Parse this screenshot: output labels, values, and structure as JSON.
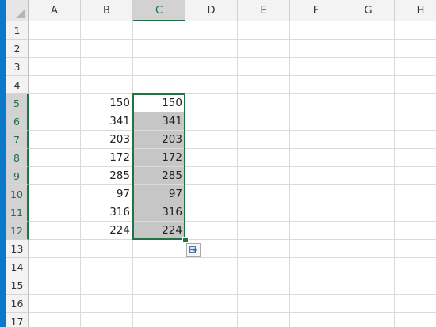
{
  "columns": [
    "A",
    "B",
    "C",
    "D",
    "E",
    "F",
    "G",
    "H"
  ],
  "selected_column": "C",
  "rows": [
    "1",
    "2",
    "3",
    "4",
    "5",
    "6",
    "7",
    "8",
    "9",
    "10",
    "11",
    "12",
    "13",
    "14",
    "15",
    "16",
    "17"
  ],
  "selected_rows": [
    "5",
    "6",
    "7",
    "8",
    "9",
    "10",
    "11",
    "12"
  ],
  "cells": {
    "B5": "150",
    "B6": "341",
    "B7": "203",
    "B8": "172",
    "B9": "285",
    "B10": "97",
    "B11": "316",
    "B12": "224",
    "C5": "150",
    "C6": "341",
    "C7": "203",
    "C8": "172",
    "C9": "285",
    "C10": "97",
    "C11": "316",
    "C12": "224"
  },
  "shaded_cells": [
    "C6",
    "C7",
    "C8",
    "C9",
    "C10",
    "C11",
    "C12"
  ],
  "selection_range": "C5:C12",
  "colors": {
    "accent": "#217346",
    "selection_fill": "#c6c6c6",
    "left_strip": "#0a79c9"
  },
  "icons": {
    "quick_analysis": "quick-analysis-icon"
  }
}
